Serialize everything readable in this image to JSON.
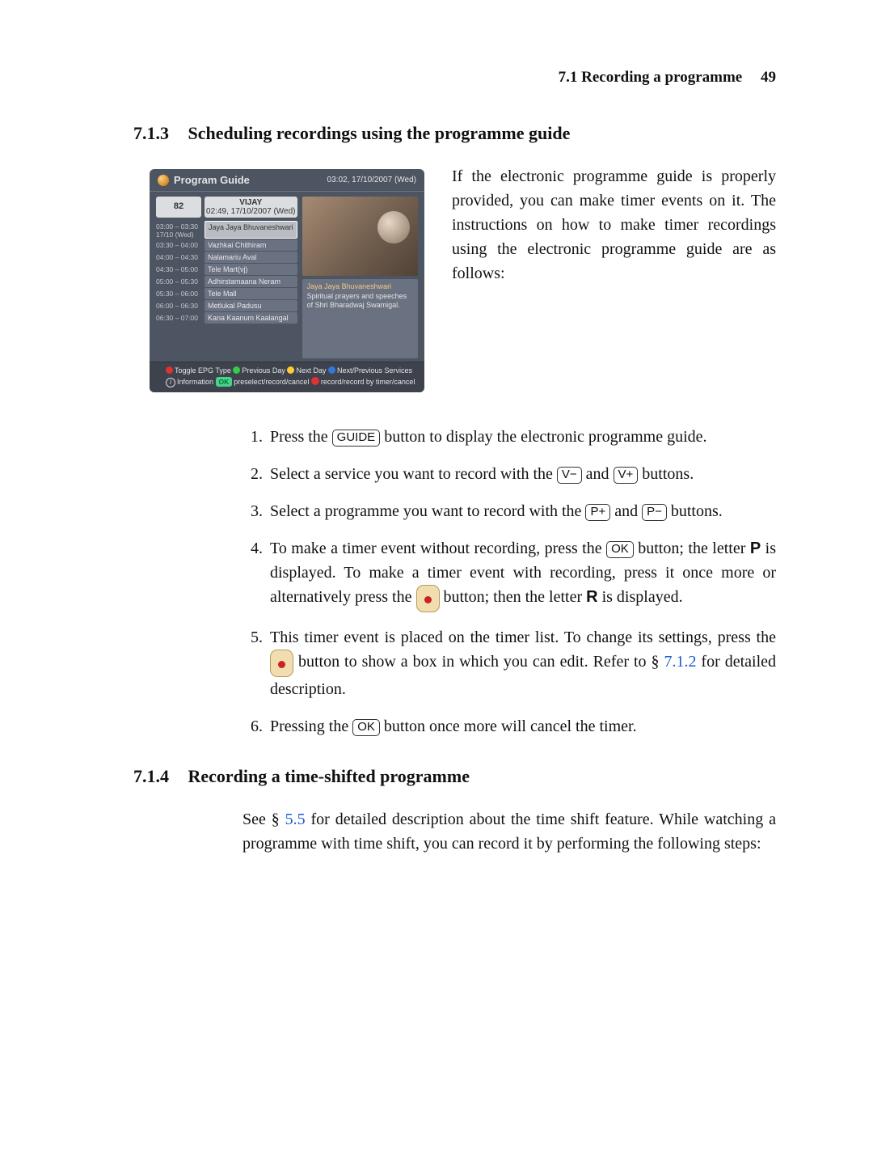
{
  "header": {
    "section": "7.1 Recording a programme",
    "page": "49"
  },
  "sec713": {
    "num": "7.1.3",
    "title": "Scheduling recordings using the programme guide"
  },
  "intro713": "If the electronic programme guide is properly provided, you can make timer events on it. The instructions on how to make timer recordings using the electronic programme guide are as follows:",
  "epg": {
    "title": "Program Guide",
    "clock": "03:02, 17/10/2007 (Wed)",
    "chnum": "82",
    "chname": "VIJAY",
    "chtime": "02:49, 17/10/2007 (Wed)",
    "rows": [
      {
        "t": "03:00 – 03:30\n17/10 (Wed)",
        "p": "Jaya Jaya Bhuvaneshwari",
        "sel": true
      },
      {
        "t": "03:30 – 04:00",
        "p": "Vazhkai Chithiram"
      },
      {
        "t": "04:00 – 04:30",
        "p": "Nalamariu Aval"
      },
      {
        "t": "04:30 – 05:00",
        "p": "Tele Mart(vj)"
      },
      {
        "t": "05:00 – 05:30",
        "p": "Adhirstamaana Neram"
      },
      {
        "t": "05:30 – 06:00",
        "p": "Tele Mall"
      },
      {
        "t": "06:00 – 06:30",
        "p": "Metlukal Padusu"
      },
      {
        "t": "06:30 – 07:00",
        "p": "Kana Kaanum Kaalangal"
      }
    ],
    "desc_title": "Jaya Jaya Bhuvaneshwari",
    "desc_body": "Spiritual prayers and speeches of Shri Bharadwaj Swamigal.",
    "foot1a": "Toggle EPG Type",
    "foot1b": "Previous Day",
    "foot1c": "Next Day",
    "foot1d": "Next/Previous Services",
    "foot2a": "Information",
    "foot2b": "OK",
    "foot2c": "preselect/record/cancel",
    "foot2d": "record/record by timer/cancel"
  },
  "steps": {
    "s1a": "Press the ",
    "s1b": " button to display the electronic programme guide.",
    "s2a": "Select a service you want to record with the ",
    "s2b": " and ",
    "s2c": " buttons.",
    "s3a": "Select a programme you want to record with the ",
    "s3b": " and ",
    "s3c": " buttons.",
    "s4a": "To make a timer event without recording, press the ",
    "s4b": " button; the letter ",
    "s4c": " is displayed. To make a timer event with recording, press it once more or alternatively press the ",
    "s4d": " button; then the letter ",
    "s4e": " is displayed.",
    "s5a": "This timer event is placed on the timer list. To change its settings, press the ",
    "s5b": " button to show a box in which you can edit. Refer to § ",
    "s5c": " for detailed description.",
    "s6a": "Pressing the ",
    "s6b": " button once more will cancel the timer."
  },
  "keys": {
    "guide": "GUIDE",
    "vminus": "V−",
    "vplus": "V+",
    "pplus": "P+",
    "pminus": "P−",
    "ok": "OK",
    "letterP": "P",
    "letterR": "R"
  },
  "ref712": "7.1.2",
  "sec714": {
    "num": "7.1.4",
    "title": "Recording a time-shifted programme"
  },
  "body714a": "See § ",
  "ref55": "5.5",
  "body714b": " for detailed description about the time shift feature. While watching a programme with time shift, you can record it by performing the following steps:"
}
